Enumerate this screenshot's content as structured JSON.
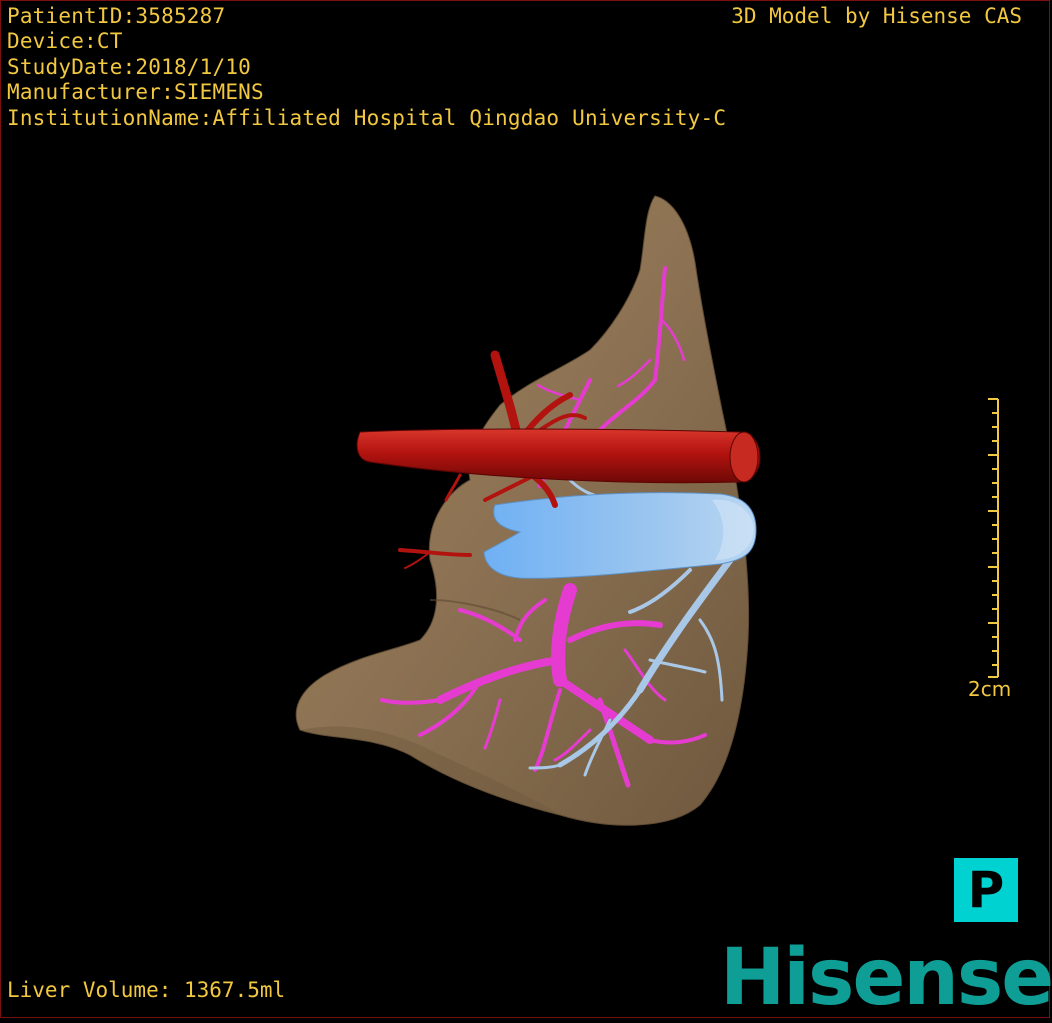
{
  "header": {
    "patient_id": "PatientID:3585287",
    "device": "Device:CT",
    "study_date": "StudyDate:2018/1/10",
    "manufacturer": "Manufacturer:SIEMENS",
    "institution": "InstitutionName:Affiliated Hospital Qingdao University-C",
    "credit": "3D Model by Hisense CAS"
  },
  "footer": {
    "liver_volume": "Liver Volume: 1367.5ml"
  },
  "scale_bar": {
    "label": "2cm"
  },
  "orientation_marker": {
    "label": "P"
  },
  "logo": {
    "text": "Hisense"
  },
  "colors": {
    "text": "#f2c840",
    "liver": "#8b7152",
    "aorta": "#b3130f",
    "portal_vein": "#e63bd0",
    "vena_cava": "#7fb6ec",
    "hepatic_vein": "#a9c8e8",
    "marker": "#00d1d1",
    "logo": "#0e9e95"
  }
}
